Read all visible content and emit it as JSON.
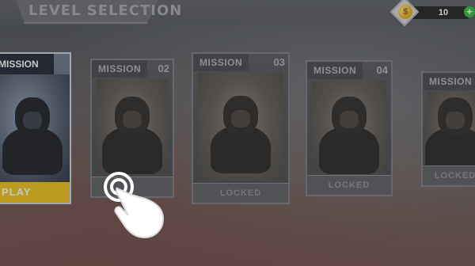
{
  "header": {
    "title": "LEVEL SELECTION"
  },
  "wallet": {
    "coins": "10",
    "coin_icon": "coin-icon",
    "add_icon": "plus-icon"
  },
  "missions": [
    {
      "label": "MISSION",
      "number": "",
      "status": "PLAY"
    },
    {
      "label": "MISSION",
      "number": "02",
      "status": ""
    },
    {
      "label": "MISSION",
      "number": "03",
      "status": "LOCKED"
    },
    {
      "label": "MISSION",
      "number": "04",
      "status": "LOCKED"
    },
    {
      "label": "MISSION",
      "number": "",
      "status": "LOCKED"
    }
  ],
  "tutorial": {
    "icon": "tap-hand-icon"
  },
  "colors": {
    "play_accent": "#f0c419",
    "coin_accent": "#e5a910",
    "plus_accent": "#2fbf3a"
  }
}
